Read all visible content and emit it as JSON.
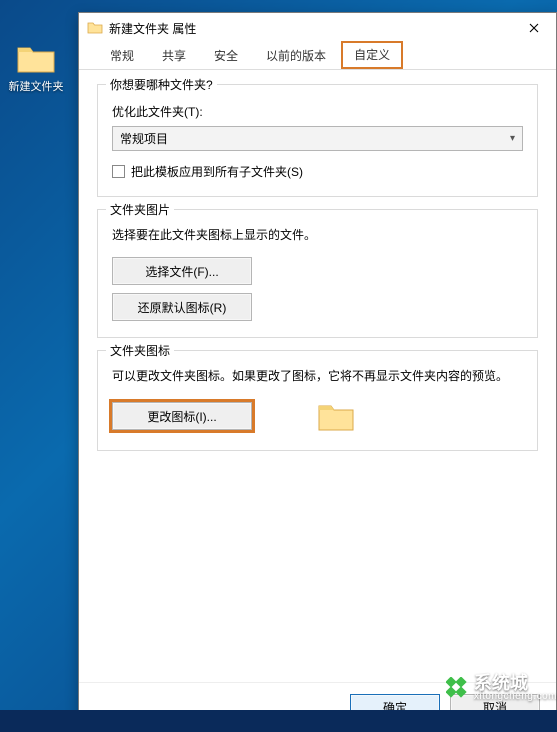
{
  "desktop": {
    "folder_label": "新建文件夹"
  },
  "dialog": {
    "title": "新建文件夹 属性"
  },
  "tabs": {
    "general": "常规",
    "share": "共享",
    "security": "安全",
    "previous": "以前的版本",
    "customize": "自定义"
  },
  "group_type": {
    "legend": "你想要哪种文件夹?",
    "optimize_label": "优化此文件夹(T):",
    "select_value": "常规项目",
    "checkbox_label": "把此模板应用到所有子文件夹(S)"
  },
  "group_picture": {
    "legend": "文件夹图片",
    "desc": "选择要在此文件夹图标上显示的文件。",
    "choose_btn": "选择文件(F)...",
    "restore_btn": "还原默认图标(R)"
  },
  "group_icon": {
    "legend": "文件夹图标",
    "desc": "可以更改文件夹图标。如果更改了图标，它将不再显示文件夹内容的预览。",
    "change_btn": "更改图标(I)..."
  },
  "footer": {
    "ok": "确定",
    "cancel": "取消"
  },
  "watermark": {
    "brand": "系统城",
    "url": "xitongcheng.com"
  }
}
